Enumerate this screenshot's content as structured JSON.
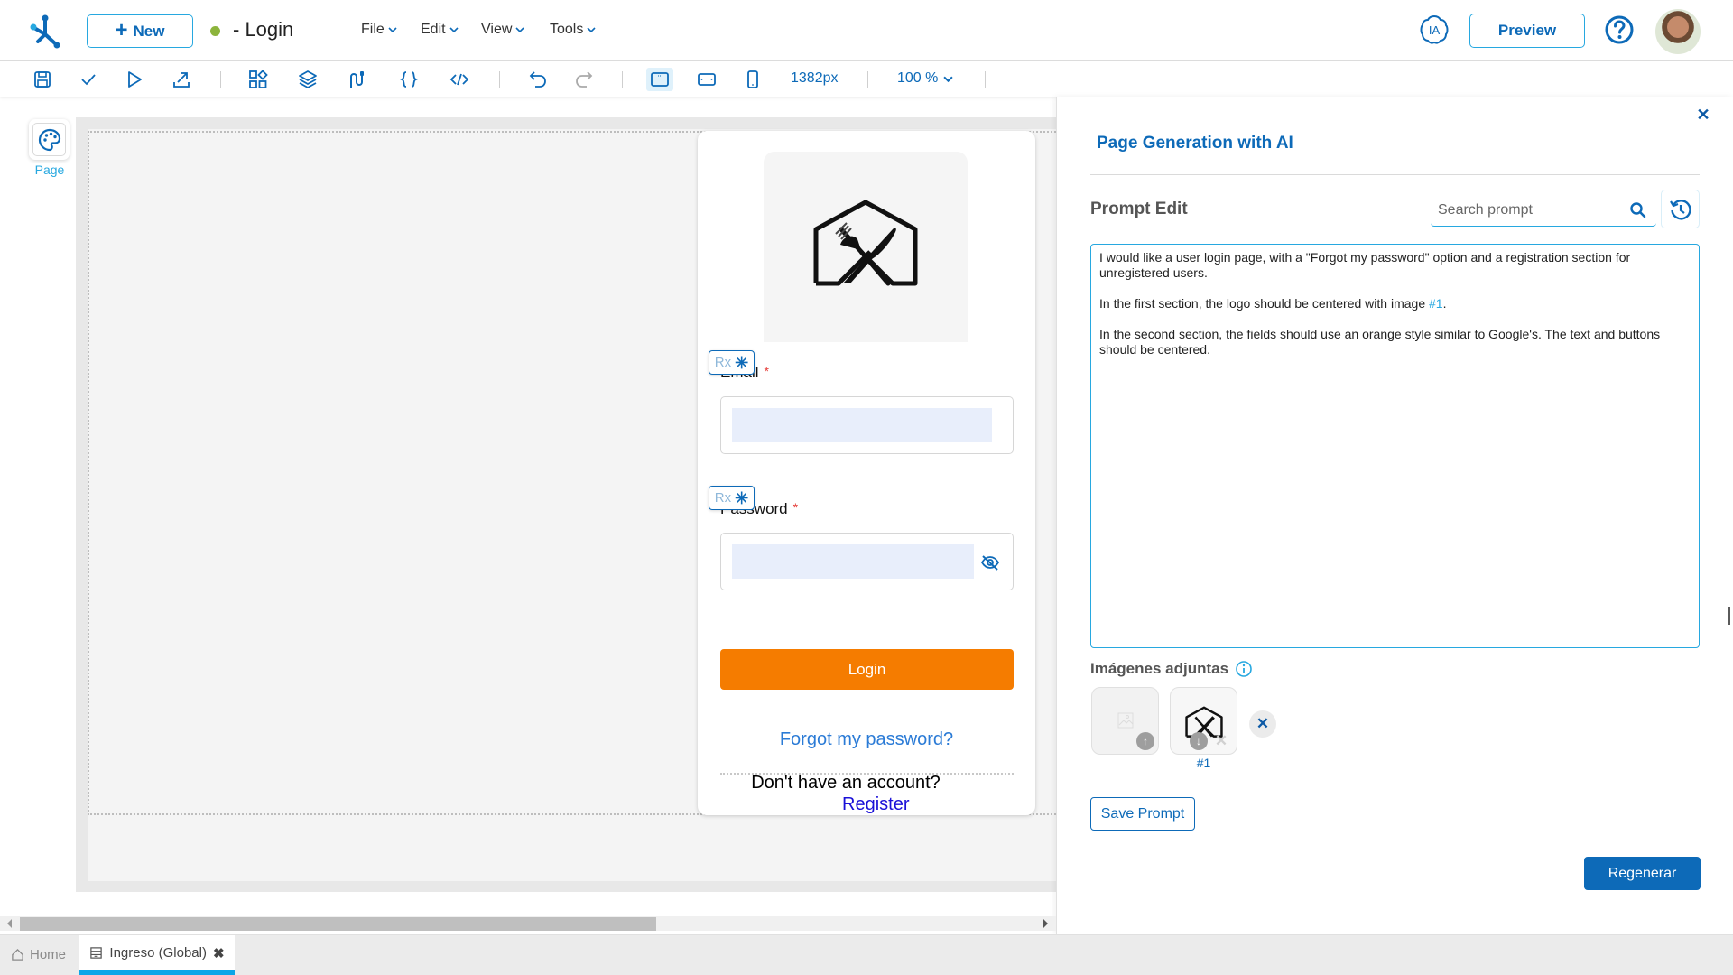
{
  "header": {
    "new_label": "New",
    "status_color": "#8cb43c",
    "page_title": "- Login",
    "menus": [
      {
        "label": "File"
      },
      {
        "label": "Edit"
      },
      {
        "label": "View"
      },
      {
        "label": "Tools"
      }
    ],
    "ia_label": "IA",
    "preview_label": "Preview"
  },
  "toolbar": {
    "icons": [
      "save-icon",
      "check-icon",
      "play-icon",
      "export-icon",
      "components-icon",
      "layers-icon",
      "integrations-icon",
      "braces-icon",
      "code-icon",
      "undo-icon",
      "redo-icon",
      "desktop-view-icon",
      "tablet-view-icon",
      "mobile-view-icon"
    ],
    "active_view": "desktop",
    "width_value": "1382px",
    "zoom_value": "100 %"
  },
  "sidebar": {
    "page_label": "Page"
  },
  "login_form": {
    "email_label": "Email",
    "email_value": "",
    "password_label": "Password",
    "password_value": "",
    "required_mark": "*",
    "rx_label": "Rx",
    "rx_icon": "✳",
    "login_button": "Login",
    "login_color": "#f57c00",
    "forgot_link": "Forgot my password?",
    "no_account_text": "Don't have an account?",
    "register_link": "Register"
  },
  "ai_panel": {
    "title": "Page Generation with AI",
    "prompt_edit_label": "Prompt Edit",
    "search_placeholder": "Search prompt",
    "prompt": {
      "p1": "I would like a user login page, with a \"Forgot my password\" option and a registration section for unregistered users.",
      "p2_before": "In the first section, the logo should be centered with image ",
      "p2_ref": "#1",
      "p2_after": ".",
      "p3": "In the second section, the fields should use an orange style similar to Google's. The text and buttons should be centered."
    },
    "attachments_label": "Imágenes adjuntas",
    "attachments": [
      {
        "label": "#1"
      }
    ],
    "save_prompt_label": "Save Prompt",
    "regenerate_label": "Regenerar",
    "accent_color": "#0d6ab8"
  },
  "bottom_tabs": [
    {
      "label": "Home",
      "active": false
    },
    {
      "label": "Ingreso (Global)",
      "active": true
    }
  ]
}
